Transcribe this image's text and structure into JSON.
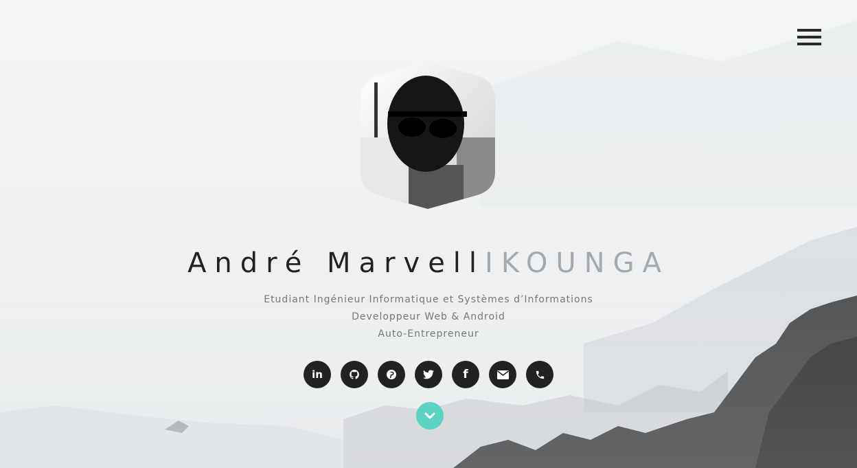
{
  "person": {
    "first_name": "André Marvell",
    "last_name": "IKOUNGA",
    "taglines": [
      "Etudiant Ingénieur Informatique et Systèmes d’Informations",
      "Developpeur Web & Android",
      "Auto-Entrepreneur"
    ]
  },
  "socials": [
    {
      "icon": "linkedin-icon",
      "glyph": "in"
    },
    {
      "icon": "github-icon",
      "glyph": ""
    },
    {
      "icon": "pinterest-icon",
      "glyph": "P"
    },
    {
      "icon": "twitter-icon",
      "glyph": ""
    },
    {
      "icon": "facebook-icon",
      "glyph": "f"
    },
    {
      "icon": "envelope-icon",
      "glyph": ""
    },
    {
      "icon": "phone-icon",
      "glyph": ""
    }
  ],
  "colors": {
    "accent": "#5bd3c2",
    "dark": "#222222",
    "muted": "#a6a9ab"
  }
}
